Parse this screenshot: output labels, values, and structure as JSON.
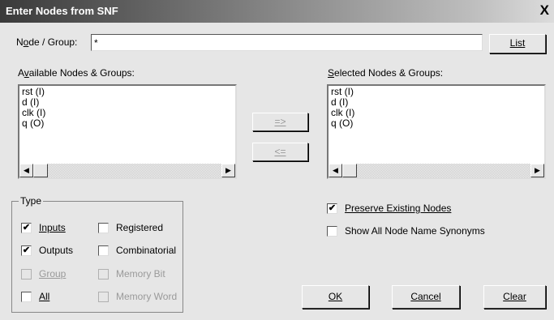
{
  "window": {
    "title": "Enter Nodes from SNF",
    "close_glyph": "X"
  },
  "node_group": {
    "label_pre": "N",
    "label_u": "o",
    "label_post": "de / Group:",
    "value": "*"
  },
  "buttons": {
    "list": "List",
    "add_arrow": "=>",
    "remove_arrow": "<=",
    "ok": "OK",
    "cancel": "Cancel",
    "clear": "Clear"
  },
  "available": {
    "label_pre": "A",
    "label_u": "v",
    "label_post": "ailable Nodes & Groups:",
    "items": [
      "rst (I)",
      "d (I)",
      "clk (I)",
      "q (O)"
    ]
  },
  "selected": {
    "label_u": "S",
    "label_post": "elected Nodes & Groups:",
    "items": [
      "rst (I)",
      "d (I)",
      "clk (I)",
      "q (O)"
    ]
  },
  "type_group": {
    "title": "Type",
    "inputs": {
      "label": "Inputs",
      "checked": true
    },
    "outputs": {
      "label": "Outputs",
      "checked": true
    },
    "group": {
      "label": "Group",
      "checked": false,
      "enabled": false
    },
    "all": {
      "label": "All",
      "checked": false
    },
    "registered": {
      "label": "Registered",
      "checked": false
    },
    "combinatorial": {
      "label": "Combinatorial",
      "checked": false
    },
    "memory_bit": {
      "label": "Memory Bit",
      "checked": false,
      "enabled": false
    },
    "memory_word": {
      "label": "Memory Word",
      "checked": false,
      "enabled": false
    }
  },
  "options": {
    "preserve_existing": {
      "label": "Preserve Existing Nodes",
      "checked": true
    },
    "show_synonyms": {
      "label": "Show All Node Name Synonyms",
      "checked": false
    }
  },
  "glyphs": {
    "check": "✔",
    "arrow_left": "◀",
    "arrow_right": "▶"
  }
}
